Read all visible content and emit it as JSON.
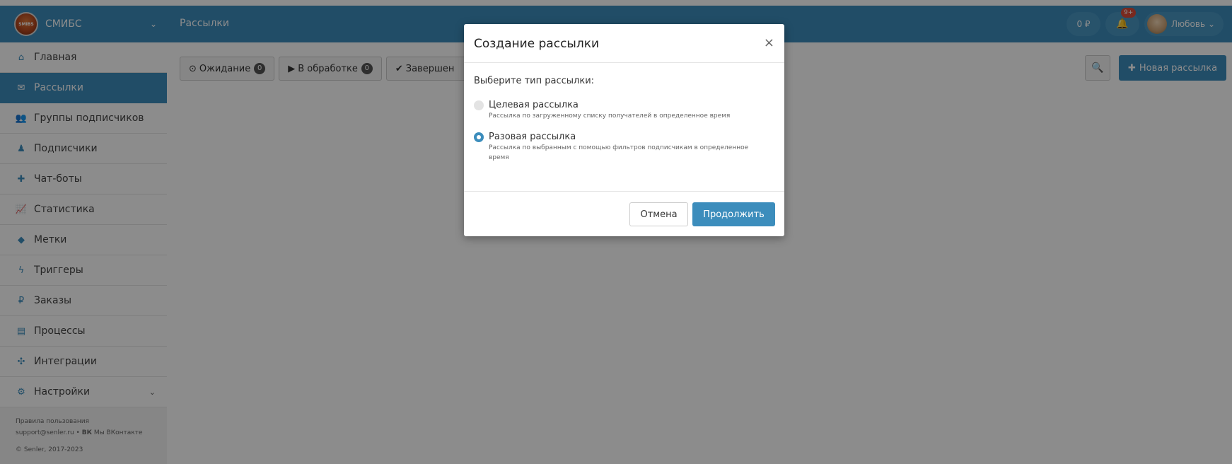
{
  "brand": {
    "name": "СМИБС",
    "logo_text": "SMIBS"
  },
  "header": {
    "title": "Рассылки",
    "balance": "0 ₽",
    "notifications_badge": "9+",
    "user_name": "Любовь",
    "user_chevron": "⌄"
  },
  "sidebar": {
    "items": [
      {
        "label": "Главная",
        "icon": "home-icon",
        "glyph": "⌂"
      },
      {
        "label": "Рассылки",
        "icon": "envelope-icon",
        "glyph": "✉"
      },
      {
        "label": "Группы подписчиков",
        "icon": "users-icon",
        "glyph": "👥"
      },
      {
        "label": "Подписчики",
        "icon": "user-icon",
        "glyph": "♟"
      },
      {
        "label": "Чат-боты",
        "icon": "bot-icon",
        "glyph": "✚"
      },
      {
        "label": "Статистика",
        "icon": "chart-icon",
        "glyph": "📈"
      },
      {
        "label": "Метки",
        "icon": "tag-icon",
        "glyph": "◆"
      },
      {
        "label": "Триггеры",
        "icon": "bolt-icon",
        "glyph": "ϟ"
      },
      {
        "label": "Заказы",
        "icon": "ruble-icon",
        "glyph": "₽"
      },
      {
        "label": "Процессы",
        "icon": "processes-icon",
        "glyph": "▤"
      },
      {
        "label": "Интеграции",
        "icon": "integrations-icon",
        "glyph": "✣"
      },
      {
        "label": "Настройки",
        "icon": "cogs-icon",
        "glyph": "⚙"
      }
    ],
    "settings_chevron": "⌄",
    "footer": {
      "rules": "Правила пользования",
      "support": "support@senler.ru",
      "separator": "•",
      "vk_icon_text": "ВК",
      "vk_link": "Мы ВКонтакте",
      "copyright": "© Senler, 2017-2023"
    }
  },
  "filters": [
    {
      "label": "Ожидание",
      "count": "0",
      "icon": "clock-icon",
      "glyph": "⊙"
    },
    {
      "label": "В обработке",
      "count": "0",
      "icon": "play-icon",
      "glyph": "▶"
    },
    {
      "label": "Завершен",
      "count": "",
      "icon": "check-icon",
      "glyph": "✔"
    }
  ],
  "toolbar": {
    "search_glyph": "🔍",
    "new_button": "Новая рассылка",
    "new_glyph": "✚"
  },
  "modal": {
    "title": "Создание рассылки",
    "close": "×",
    "prompt": "Выберите тип рассылки:",
    "options": [
      {
        "title": "Целевая рассылка",
        "desc": "Рассылка по загруженному списку получателей в определенное время",
        "selected": false
      },
      {
        "title": "Разовая рассылка",
        "desc": "Рассылка по выбранным с помощью фильтров подписчикам в определенное время",
        "selected": true
      }
    ],
    "cancel": "Отмена",
    "continue": "Продолжить"
  }
}
